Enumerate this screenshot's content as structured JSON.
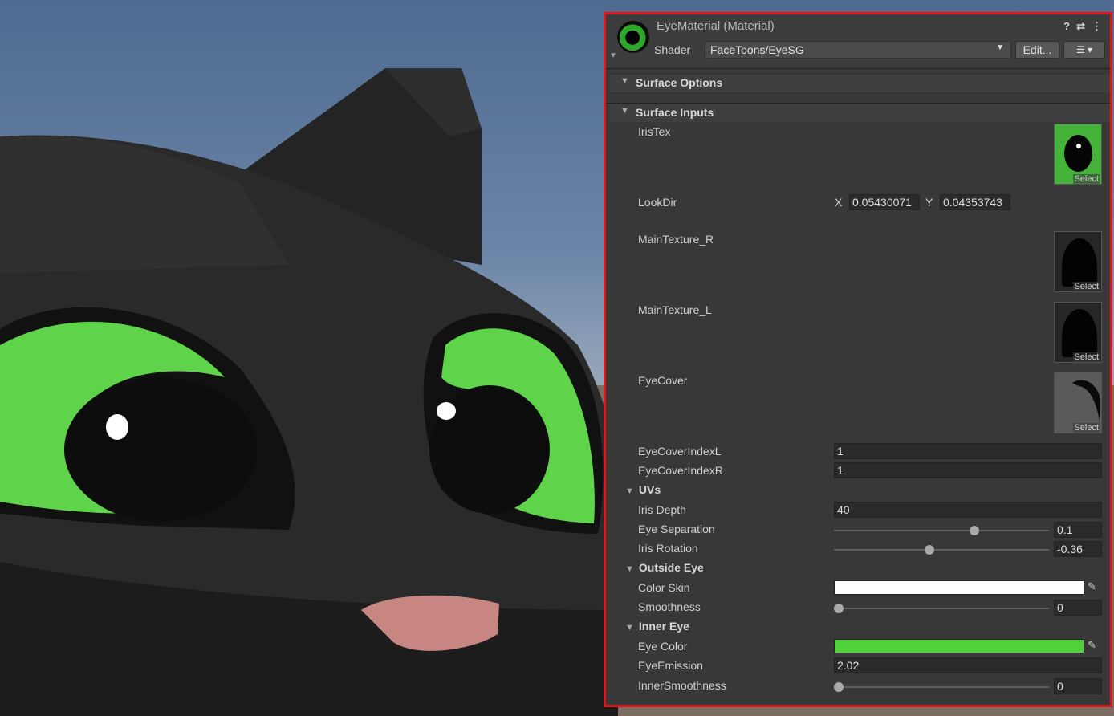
{
  "inspector": {
    "material_title": "EyeMaterial (Material)",
    "header_icons": [
      "help-icon",
      "settings-sliders-icon",
      "more-vert-icon"
    ],
    "help_glyph": "?",
    "sliders_glyph": "⇄",
    "more_glyph": "⋮",
    "shader_label": "Shader",
    "shader_value": "FaceToons/EyeSG",
    "edit_label": "Edit...",
    "menu_glyph": "☰ ▾",
    "sections": {
      "surface_options": "Surface Options",
      "surface_inputs": "Surface Inputs"
    },
    "textures": {
      "iris": {
        "label": "IrisTex",
        "select": "Select"
      },
      "main_r": {
        "label": "MainTexture_R",
        "select": "Select"
      },
      "main_l": {
        "label": "MainTexture_L",
        "select": "Select"
      },
      "eye_cover": {
        "label": "EyeCover",
        "select": "Select"
      }
    },
    "look_dir": {
      "label": "LookDir",
      "x_label": "X",
      "x_value": "0.05430071",
      "y_label": "Y",
      "y_value": "0.04353743"
    },
    "eye_cover_index_l": {
      "label": "EyeCoverIndexL",
      "value": "1"
    },
    "eye_cover_index_r": {
      "label": "EyeCoverIndexR",
      "value": "1"
    },
    "uvs": {
      "title": "UVs",
      "iris_depth": {
        "label": "Iris Depth",
        "value": "40"
      },
      "eye_separation": {
        "label": "Eye Separation",
        "value": "0.1",
        "slider_fraction": 0.66
      },
      "iris_rotation": {
        "label": "Iris Rotation",
        "value": "-0.36",
        "slider_fraction": 0.44
      }
    },
    "outside_eye": {
      "title": "Outside Eye",
      "color_skin": {
        "label": "Color Skin",
        "color": "#ffffff"
      },
      "smoothness": {
        "label": "Smoothness",
        "value": "0",
        "slider_fraction": 0.0
      }
    },
    "inner_eye": {
      "title": "Inner Eye",
      "eye_color": {
        "label": "Eye Color",
        "color": "#4fd13a"
      },
      "eye_emission": {
        "label": "EyeEmission",
        "value": "2.02"
      },
      "inner_smoothness": {
        "label": "InnerSmoothness",
        "value": "0",
        "slider_fraction": 0.0
      }
    }
  },
  "colors": {
    "panel_border": "#e0161c",
    "eye_green": "#5fd44a",
    "panel_bg": "#383838"
  }
}
